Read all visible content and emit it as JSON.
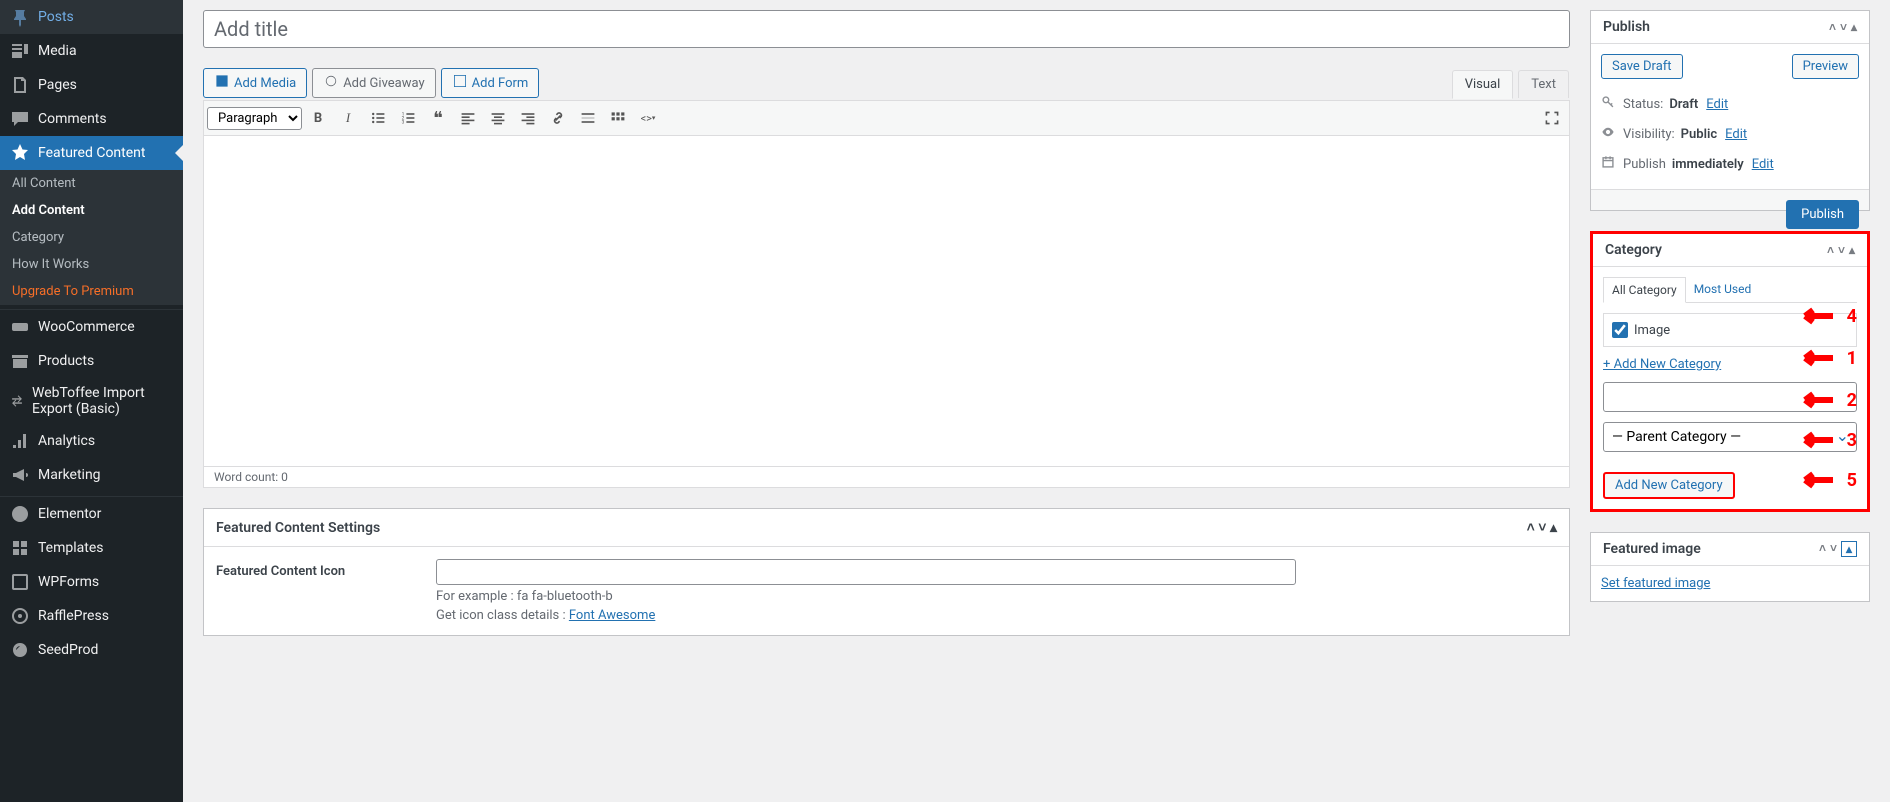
{
  "sidebar": {
    "items": [
      {
        "label": "Posts",
        "icon": "pin"
      },
      {
        "label": "Media",
        "icon": "media"
      },
      {
        "label": "Pages",
        "icon": "page"
      },
      {
        "label": "Comments",
        "icon": "comment"
      },
      {
        "label": "Featured Content",
        "icon": "star",
        "active": true
      },
      {
        "label": "WooCommerce",
        "icon": "woo"
      },
      {
        "label": "Products",
        "icon": "archive"
      },
      {
        "label": "WebToffee Import Export (Basic)",
        "icon": "transfer"
      },
      {
        "label": "Analytics",
        "icon": "chart"
      },
      {
        "label": "Marketing",
        "icon": "megaphone"
      },
      {
        "label": "Elementor",
        "icon": "elementor"
      },
      {
        "label": "Templates",
        "icon": "templates"
      },
      {
        "label": "WPForms",
        "icon": "wpforms"
      },
      {
        "label": "RafflePress",
        "icon": "raffle"
      },
      {
        "label": "SeedProd",
        "icon": "seed"
      }
    ],
    "sub": [
      {
        "label": "All Content"
      },
      {
        "label": "Add Content",
        "active": true
      },
      {
        "label": "Category"
      },
      {
        "label": "How It Works"
      },
      {
        "label": "Upgrade To Premium",
        "upgrade": true
      }
    ]
  },
  "editor": {
    "title_placeholder": "Add title",
    "add_media": "Add Media",
    "add_giveaway": "Add Giveaway",
    "add_form": "Add Form",
    "tab_visual": "Visual",
    "tab_text": "Text",
    "format_select": "Paragraph",
    "word_count": "Word count: 0"
  },
  "featured_settings": {
    "title": "Featured Content Settings",
    "icon_label": "Featured Content Icon",
    "hint1": "For example : fa fa-bluetooth-b",
    "hint2_prefix": "Get icon class details : ",
    "hint2_link": "Font Awesome"
  },
  "publish": {
    "title": "Publish",
    "save_draft": "Save Draft",
    "preview": "Preview",
    "status_label": "Status:",
    "status_value": "Draft",
    "visibility_label": "Visibility:",
    "visibility_value": "Public",
    "publish_label": "Publish",
    "publish_value": "immediately",
    "edit": "Edit",
    "publish_btn": "Publish"
  },
  "category": {
    "title": "Category",
    "tab_all": "All Category",
    "tab_most": "Most Used",
    "item_image": "Image",
    "add_link": "+ Add New Category",
    "parent_placeholder": "— Parent Category —",
    "add_btn": "Add New Category"
  },
  "featured_image": {
    "title": "Featured image",
    "set_link": "Set featured image"
  },
  "annotations": {
    "a1": "1",
    "a2": "2",
    "a3": "3",
    "a4": "4",
    "a5": "5"
  }
}
